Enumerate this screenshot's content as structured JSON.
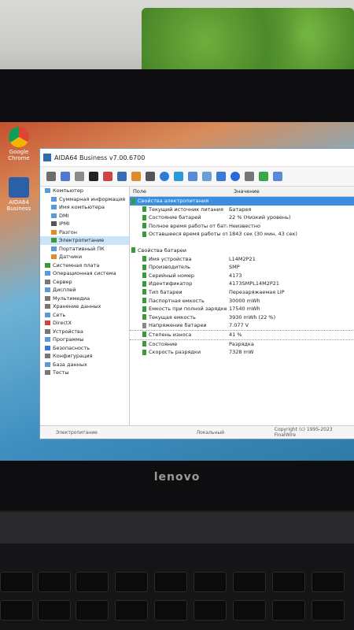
{
  "window": {
    "title": "AIDA64 Business v7.00.6700"
  },
  "desktop": {
    "icons": [
      {
        "label": "Google Chrome"
      },
      {
        "label": "AIDA64 Business"
      }
    ]
  },
  "tree": {
    "items": [
      {
        "label": "Компьютер"
      },
      {
        "label": "Суммарная информация"
      },
      {
        "label": "Имя компьютера"
      },
      {
        "label": "DMI"
      },
      {
        "label": "IPMI"
      },
      {
        "label": "Разгон"
      },
      {
        "label": "Электропитание"
      },
      {
        "label": "Портативный ПК"
      },
      {
        "label": "Датчики"
      },
      {
        "label": "Системная плата"
      },
      {
        "label": "Операционная система"
      },
      {
        "label": "Сервер"
      },
      {
        "label": "Дисплей"
      },
      {
        "label": "Мультимедиа"
      },
      {
        "label": "Хранение данных"
      },
      {
        "label": "Сеть"
      },
      {
        "label": "DirectX"
      },
      {
        "label": "Устройства"
      },
      {
        "label": "Программы"
      },
      {
        "label": "Безопасность"
      },
      {
        "label": "Конфигурация"
      },
      {
        "label": "База данных"
      },
      {
        "label": "Тесты"
      }
    ]
  },
  "columns": {
    "field": "Поле",
    "value": "Значение"
  },
  "power": {
    "section": "Свойства электропитания",
    "rows": [
      {
        "field": "Текущий источник питания",
        "value": "Батарея"
      },
      {
        "field": "Состояние батарей",
        "value": "22 % (Низкий уровень)"
      },
      {
        "field": "Полное время работы от бата...",
        "value": "Неизвестно"
      },
      {
        "field": "Оставшееся время работы от ...",
        "value": "1843 сек (30 мин, 43 сек)"
      }
    ]
  },
  "battery": {
    "section": "Свойства батареи",
    "rows": [
      {
        "field": "Имя устройства",
        "value": "L14M2P21"
      },
      {
        "field": "Производитель",
        "value": "SMP"
      },
      {
        "field": "Серийный номер",
        "value": "4173"
      },
      {
        "field": "Идентификатор",
        "value": "4173SMPL14M2P21"
      },
      {
        "field": "Тип батареи",
        "value": "Перезаряжаемая LiP"
      },
      {
        "field": "Паспортная емкость",
        "value": "30000 mWh"
      },
      {
        "field": "Емкость при полной зарядке",
        "value": "17540 mWh"
      },
      {
        "field": "Текущая емкость",
        "value": "3930 mWh (22 %)"
      },
      {
        "field": "Напряжение батареи",
        "value": "7.077 V"
      },
      {
        "field": "Степень износа",
        "value": "41 %"
      },
      {
        "field": "Состояние",
        "value": "Разрядка"
      },
      {
        "field": "Скорость разрядки",
        "value": "7328 mW"
      }
    ]
  },
  "statusbar": {
    "left": "Электропитание",
    "mid": "Локальный",
    "right": "Copyright (c) 1995-2023 FinalWire"
  },
  "brand": "lenovo"
}
